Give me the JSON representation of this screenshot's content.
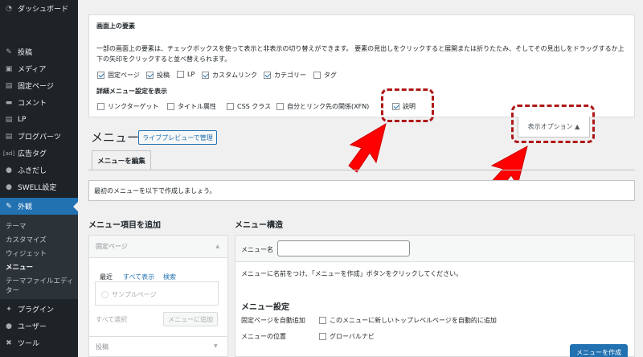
{
  "sidebar": {
    "items": [
      {
        "icon": "dashboard-icon",
        "glyph": "◔",
        "label": "ダッシュボード"
      },
      {
        "icon": "pin-icon",
        "glyph": "✎",
        "label": "投稿"
      },
      {
        "icon": "media-icon",
        "glyph": "▣",
        "label": "メディア"
      },
      {
        "icon": "page-icon",
        "glyph": "▤",
        "label": "固定ページ"
      },
      {
        "icon": "comment-icon",
        "glyph": "▬",
        "label": "コメント"
      },
      {
        "icon": "lp-icon",
        "glyph": "▤",
        "label": "LP"
      },
      {
        "icon": "blog-parts-icon",
        "glyph": "▤",
        "label": "ブログパーツ"
      },
      {
        "icon": "ad-tag-icon",
        "glyph": "[ad]",
        "label": "広告タグ"
      },
      {
        "icon": "balloon-icon",
        "glyph": "●",
        "label": "ふきだし"
      },
      {
        "icon": "swell-icon",
        "glyph": "●",
        "label": "SWELL設定"
      },
      {
        "icon": "appearance-icon",
        "glyph": "✎",
        "label": "外観"
      },
      {
        "icon": "plugin-icon",
        "glyph": "✦",
        "label": "プラグイン"
      },
      {
        "icon": "user-icon",
        "glyph": "●",
        "label": "ユーザー"
      },
      {
        "icon": "tool-icon",
        "glyph": "✖",
        "label": "ツール"
      }
    ],
    "subitems": [
      "テーマ",
      "カスタマイズ",
      "ウィジェット",
      "メニュー",
      "テーマファイルエディ",
      "ター"
    ]
  },
  "screen_options": {
    "title": "画面上の要素",
    "desc_line1": "一部の画面上の要素は、チェックボックスを使って表示と非表示の切り替えができます。 要素の見出しをクリックすると展開または折りたたみ、そしてその見出しをドラッグするか上",
    "desc_line2": "下の矢印をクリックすると並べ替えられます。",
    "elements": [
      {
        "label": "固定ページ",
        "checked": true
      },
      {
        "label": "投稿",
        "checked": true
      },
      {
        "label": "LP",
        "checked": false
      },
      {
        "label": "カスタムリンク",
        "checked": true
      },
      {
        "label": "カテゴリー",
        "checked": true
      },
      {
        "label": "タグ",
        "checked": false
      }
    ],
    "advanced_title": "詳細メニュー設定を表示",
    "advanced": [
      {
        "label": "リンクターゲット",
        "checked": false
      },
      {
        "label": "タイトル属性",
        "checked": false
      },
      {
        "label": "CSS クラス",
        "checked": false
      },
      {
        "label": "自分とリンク先の関係(XFN)",
        "checked": false
      },
      {
        "label": "説明",
        "checked": true
      }
    ],
    "toggle_label": "表示オプション ▲"
  },
  "menu": {
    "heading": "メニュー",
    "live_preview": "ライブプレビューで管理",
    "tab_edit": "メニューを編集",
    "notice": "最初のメニューを以下で作成しましょう。"
  },
  "add_items": {
    "heading": "メニュー項目を追加",
    "accordion_title": "固定ページ",
    "tabs": [
      "最近",
      "すべて表示",
      "検索"
    ],
    "sample_page": "サンプルページ",
    "select_all": "すべて選択",
    "add_button": "メニューに追加",
    "next_accordion": "投稿"
  },
  "structure": {
    "heading": "メニュー構造",
    "name_label": "メニュー名",
    "name_value": "",
    "instructions": "メニューに名前をつけ、「メニューを作成」ボタンをクリックしてください。",
    "settings_heading": "メニュー設定",
    "auto_add_label": "固定ページを自動追加",
    "auto_add_text": "このメニューに新しいトップレベルページを自動的に追加",
    "location_label": "メニューの位置",
    "location_text": "グローバルナビ",
    "create_button": "メニューを作成"
  },
  "colors": {
    "annotation_red": "#b01818",
    "arrow_red": "#ff0000",
    "wp_blue": "#2271b1"
  }
}
